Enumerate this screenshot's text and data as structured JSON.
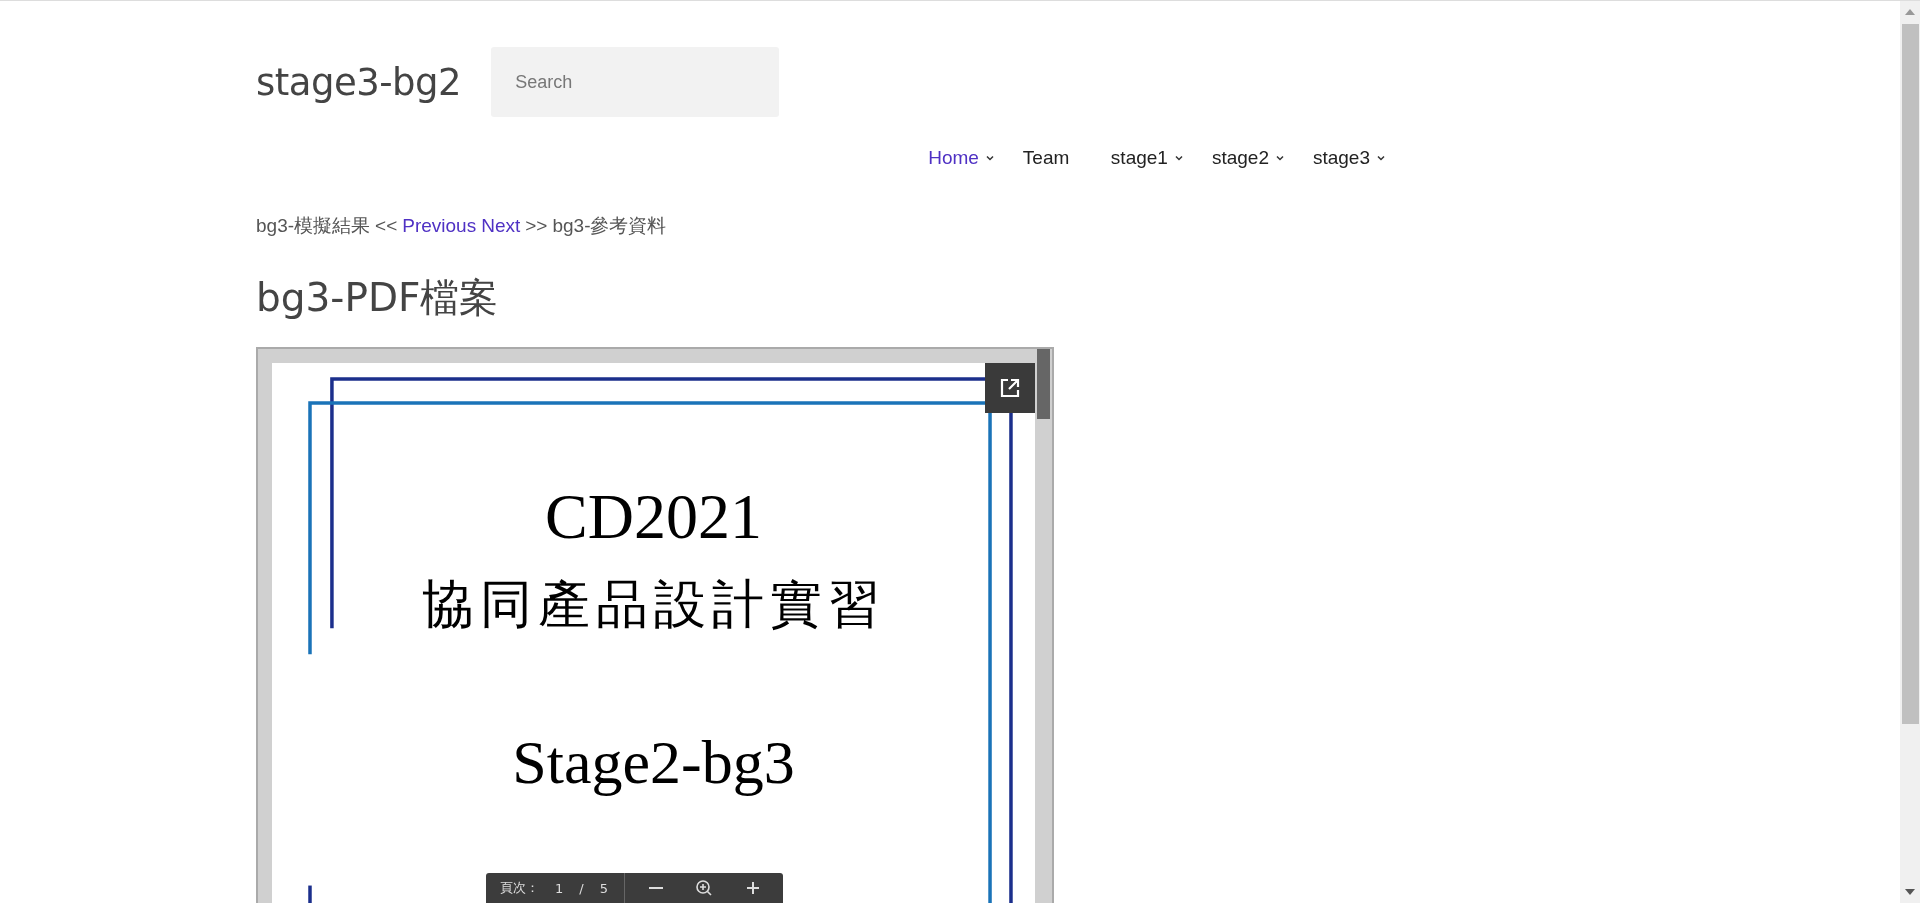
{
  "site": {
    "title": "stage3-bg2",
    "search": {
      "placeholder": "Search"
    }
  },
  "nav": [
    {
      "label": "Home",
      "selected": true,
      "dropdown": true
    },
    {
      "label": "Team",
      "selected": false,
      "dropdown": false
    },
    {
      "label": "stage1",
      "selected": false,
      "dropdown": true
    },
    {
      "label": "stage2",
      "selected": false,
      "dropdown": true
    },
    {
      "label": "stage3",
      "selected": false,
      "dropdown": true
    }
  ],
  "post_nav": {
    "previous_title": "bg3-模擬結果",
    "previous_arrow": "<<",
    "previous_link": "Previous",
    "next_link": "Next",
    "next_arrow": ">>",
    "next_title": "bg3-參考資料"
  },
  "heading": "bg3-PDF檔案",
  "pdf_viewer": {
    "page_lines": [
      "CD2021",
      "協同產品設計實習",
      "Stage2-bg3"
    ],
    "toolbar": {
      "page_label": "頁次：",
      "current_page": "1",
      "separator": "/",
      "total_pages": "5"
    }
  }
}
